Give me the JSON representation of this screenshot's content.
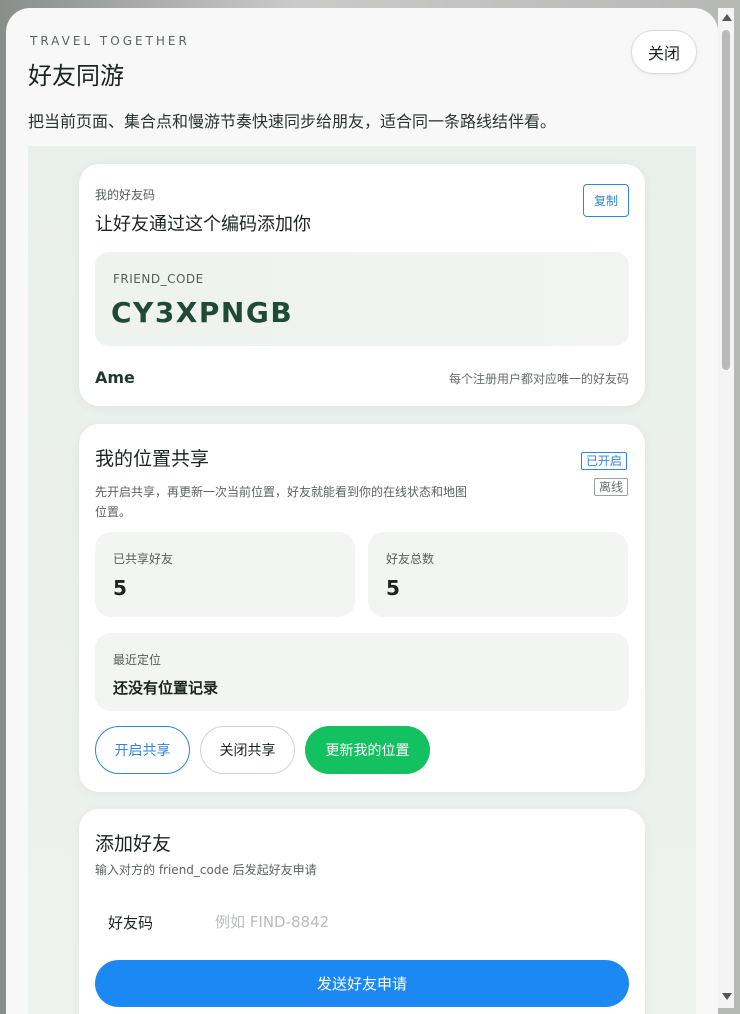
{
  "header": {
    "eyebrow": "TRAVEL TOGETHER",
    "title": "好友同游",
    "close_label": "关闭",
    "subtitle": "把当前页面、集合点和慢游节奏快速同步给朋友，适合同一条路线结伴看。"
  },
  "friend_code_card": {
    "label": "我的好友码",
    "heading": "让好友通过这个编码添加你",
    "copy_label": "复制",
    "code_label": "FRIEND_CODE",
    "code_value": "CY3XPNGB",
    "user_name": "Ame",
    "note": "每个注册用户都对应唯一的好友码"
  },
  "location_card": {
    "heading": "我的位置共享",
    "description_line1": "先开启共享，再更新一次当前位置，好友就能看到你的在线状态和地图",
    "description_line2": "位置。",
    "badge_enabled": "已开启",
    "badge_offline": "离线",
    "stats": [
      {
        "label": "已共享好友",
        "value": "5"
      },
      {
        "label": "好友总数",
        "value": "5"
      }
    ],
    "last_location_label": "最近定位",
    "last_location_value": "还没有位置记录",
    "buttons": {
      "enable": "开启共享",
      "disable": "关闭共享",
      "update": "更新我的位置"
    }
  },
  "add_friend_card": {
    "heading": "添加好友",
    "description": "输入对方的 friend_code 后发起好友申请",
    "field_label": "好友码",
    "field_placeholder": "例如 FIND-8842",
    "field_value": "",
    "submit_label": "发送好友申请"
  },
  "colors": {
    "accent_blue": "#1c88f3",
    "accent_green": "#14c160",
    "code_green": "#1f4a36"
  }
}
